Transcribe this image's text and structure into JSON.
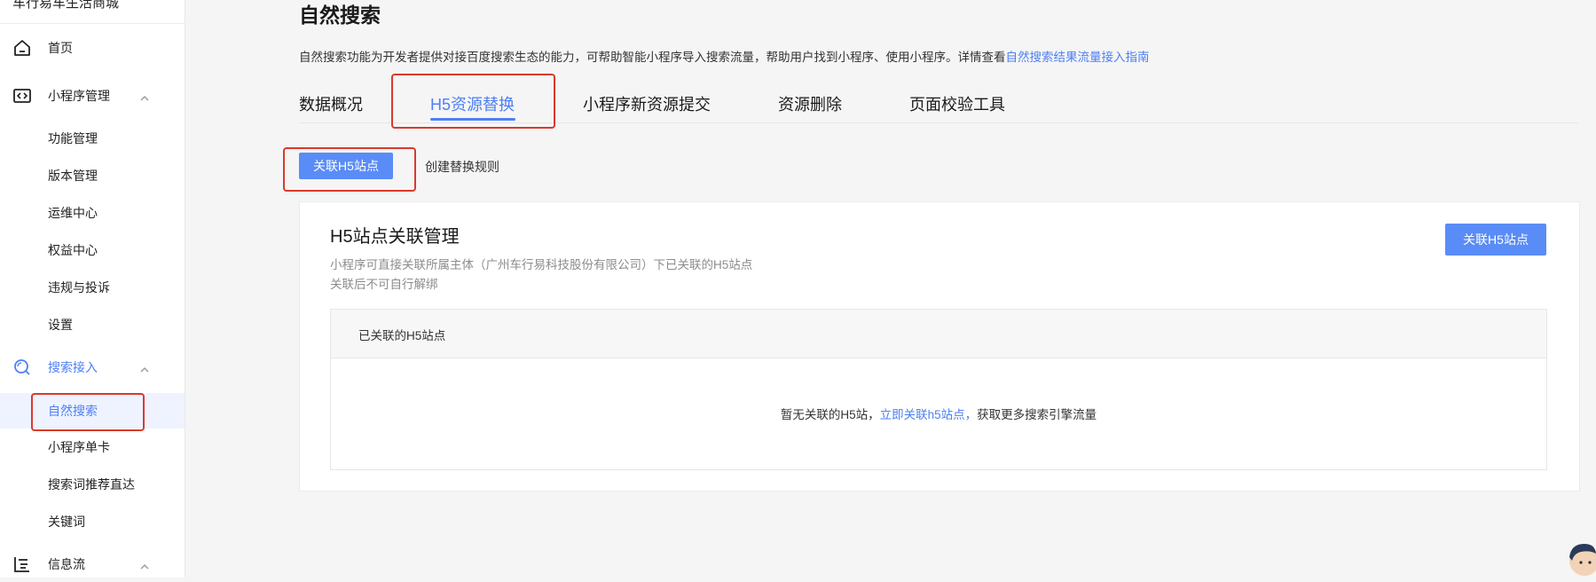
{
  "sidebar": {
    "brand": "车行易车生活商城",
    "items": [
      {
        "label": "首页",
        "icon": "home-icon"
      },
      {
        "label": "小程序管理",
        "icon": "code-icon"
      },
      {
        "label": "功能管理"
      },
      {
        "label": "版本管理"
      },
      {
        "label": "运维中心"
      },
      {
        "label": "权益中心"
      },
      {
        "label": "违规与投诉"
      },
      {
        "label": "设置"
      },
      {
        "label": "搜索接入",
        "icon": "search-icon"
      },
      {
        "label": "自然搜索"
      },
      {
        "label": "小程序单卡"
      },
      {
        "label": "搜索词推荐直达"
      },
      {
        "label": "关键词"
      },
      {
        "label": "信息流",
        "icon": "feed-icon"
      }
    ]
  },
  "header": {
    "title": "自然搜索",
    "description": "自然搜索功能为开发者提供对接百度搜索生态的能力，可帮助智能小程序导入搜索流量，帮助用户找到小程序、使用小程序。详情查看",
    "guide_link": "自然搜索结果流量接入指南"
  },
  "tabs": [
    {
      "label": "数据概况"
    },
    {
      "label": "H5资源替换"
    },
    {
      "label": "小程序新资源提交"
    },
    {
      "label": "资源删除"
    },
    {
      "label": "页面校验工具"
    }
  ],
  "subnav": {
    "link_h5_button": "关联H5站点",
    "create_rule_link": "创建替换规则"
  },
  "card": {
    "title": "H5站点关联管理",
    "subtitle_line1": "小程序可直接关联所属主体（广州车行易科技股份有限公司）下已关联的H5站点",
    "subtitle_line2": "关联后不可自行解绑",
    "link_button": "关联H5站点",
    "table_header": "已关联的H5站点",
    "empty_prefix": "暂无关联的H5站，",
    "empty_link": "立即关联h5站点，",
    "empty_suffix": "获取更多搜索引擎流量"
  },
  "colors": {
    "accent": "#4e7ff5",
    "button": "#5a8cf7",
    "highlight": "#d93a2b"
  }
}
